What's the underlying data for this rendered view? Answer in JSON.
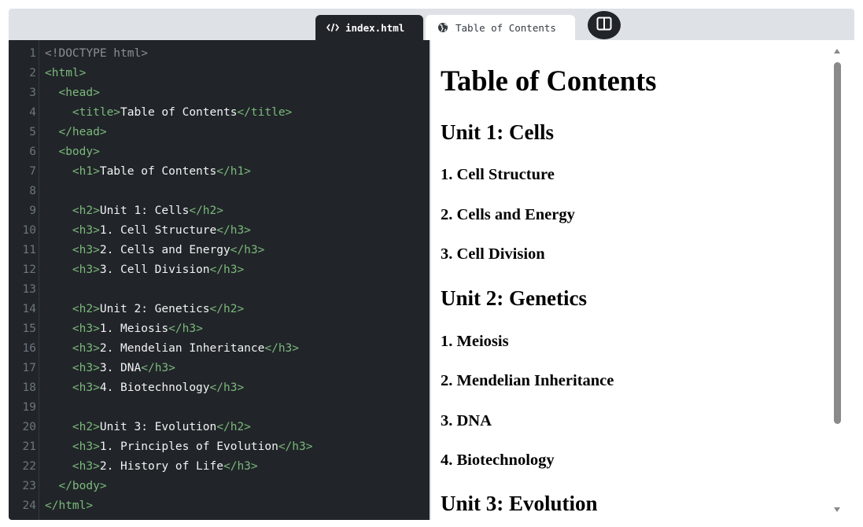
{
  "tabs": {
    "code": {
      "label": "index.html",
      "icon": "code-icon"
    },
    "preview": {
      "label": "Table of Contents",
      "icon": "globe-icon"
    },
    "layout_toggle": {
      "icon": "split-layout-icon"
    }
  },
  "editor": {
    "lines": [
      {
        "n": "1",
        "p": [
          [
            "doctype",
            "<!DOCTYPE html>"
          ]
        ]
      },
      {
        "n": "2",
        "p": [
          [
            "tag",
            "<html>"
          ]
        ]
      },
      {
        "n": "3",
        "p": [
          [
            "txt",
            "  "
          ],
          [
            "tag",
            "<head>"
          ]
        ]
      },
      {
        "n": "4",
        "p": [
          [
            "txt",
            "    "
          ],
          [
            "tag",
            "<title>"
          ],
          [
            "txt",
            "Table of Contents"
          ],
          [
            "tag",
            "</title>"
          ]
        ]
      },
      {
        "n": "5",
        "p": [
          [
            "txt",
            "  "
          ],
          [
            "tag",
            "</head>"
          ]
        ]
      },
      {
        "n": "6",
        "p": [
          [
            "txt",
            "  "
          ],
          [
            "tag",
            "<body>"
          ]
        ]
      },
      {
        "n": "7",
        "p": [
          [
            "txt",
            "    "
          ],
          [
            "tag",
            "<h1>"
          ],
          [
            "txt",
            "Table of Contents"
          ],
          [
            "tag",
            "</h1>"
          ]
        ]
      },
      {
        "n": "8",
        "p": []
      },
      {
        "n": "9",
        "p": [
          [
            "txt",
            "    "
          ],
          [
            "tag",
            "<h2>"
          ],
          [
            "txt",
            "Unit 1: Cells"
          ],
          [
            "tag",
            "</h2>"
          ]
        ]
      },
      {
        "n": "10",
        "p": [
          [
            "txt",
            "    "
          ],
          [
            "tag",
            "<h3>"
          ],
          [
            "txt",
            "1. Cell Structure"
          ],
          [
            "tag",
            "</h3>"
          ]
        ]
      },
      {
        "n": "11",
        "p": [
          [
            "txt",
            "    "
          ],
          [
            "tag",
            "<h3>"
          ],
          [
            "txt",
            "2. Cells and Energy"
          ],
          [
            "tag",
            "</h3>"
          ]
        ]
      },
      {
        "n": "12",
        "p": [
          [
            "txt",
            "    "
          ],
          [
            "tag",
            "<h3>"
          ],
          [
            "txt",
            "3. Cell Division"
          ],
          [
            "tag",
            "</h3>"
          ]
        ]
      },
      {
        "n": "13",
        "p": []
      },
      {
        "n": "14",
        "p": [
          [
            "txt",
            "    "
          ],
          [
            "tag",
            "<h2>"
          ],
          [
            "txt",
            "Unit 2: Genetics"
          ],
          [
            "tag",
            "</h2>"
          ]
        ]
      },
      {
        "n": "15",
        "p": [
          [
            "txt",
            "    "
          ],
          [
            "tag",
            "<h3>"
          ],
          [
            "txt",
            "1. Meiosis"
          ],
          [
            "tag",
            "</h3>"
          ]
        ]
      },
      {
        "n": "16",
        "p": [
          [
            "txt",
            "    "
          ],
          [
            "tag",
            "<h3>"
          ],
          [
            "txt",
            "2. Mendelian Inheritance"
          ],
          [
            "tag",
            "</h3>"
          ]
        ]
      },
      {
        "n": "17",
        "p": [
          [
            "txt",
            "    "
          ],
          [
            "tag",
            "<h3>"
          ],
          [
            "txt",
            "3. DNA"
          ],
          [
            "tag",
            "</h3>"
          ]
        ]
      },
      {
        "n": "18",
        "p": [
          [
            "txt",
            "    "
          ],
          [
            "tag",
            "<h3>"
          ],
          [
            "txt",
            "4. Biotechnology"
          ],
          [
            "tag",
            "</h3>"
          ]
        ]
      },
      {
        "n": "19",
        "p": []
      },
      {
        "n": "20",
        "p": [
          [
            "txt",
            "    "
          ],
          [
            "tag",
            "<h2>"
          ],
          [
            "txt",
            "Unit 3: Evolution"
          ],
          [
            "tag",
            "</h2>"
          ]
        ]
      },
      {
        "n": "21",
        "p": [
          [
            "txt",
            "    "
          ],
          [
            "tag",
            "<h3>"
          ],
          [
            "txt",
            "1. Principles of Evolution"
          ],
          [
            "tag",
            "</h3>"
          ]
        ]
      },
      {
        "n": "22",
        "p": [
          [
            "txt",
            "    "
          ],
          [
            "tag",
            "<h3>"
          ],
          [
            "txt",
            "2. History of Life"
          ],
          [
            "tag",
            "</h3>"
          ]
        ]
      },
      {
        "n": "23",
        "p": [
          [
            "txt",
            "  "
          ],
          [
            "tag",
            "</body>"
          ]
        ]
      },
      {
        "n": "24",
        "p": [
          [
            "tag",
            "</html>"
          ]
        ]
      }
    ]
  },
  "preview": {
    "h1": "Table of Contents",
    "unit1": "Unit 1: Cells",
    "u1_1": "1. Cell Structure",
    "u1_2": "2. Cells and Energy",
    "u1_3": "3. Cell Division",
    "unit2": "Unit 2: Genetics",
    "u2_1": "1. Meiosis",
    "u2_2": "2. Mendelian Inheritance",
    "u2_3": "3. DNA",
    "u2_4": "4. Biotechnology",
    "unit3": "Unit 3: Evolution"
  },
  "colors": {
    "editor_bg": "#212529",
    "tag": "#7cb87c",
    "frame_bg": "#dee2e6"
  }
}
